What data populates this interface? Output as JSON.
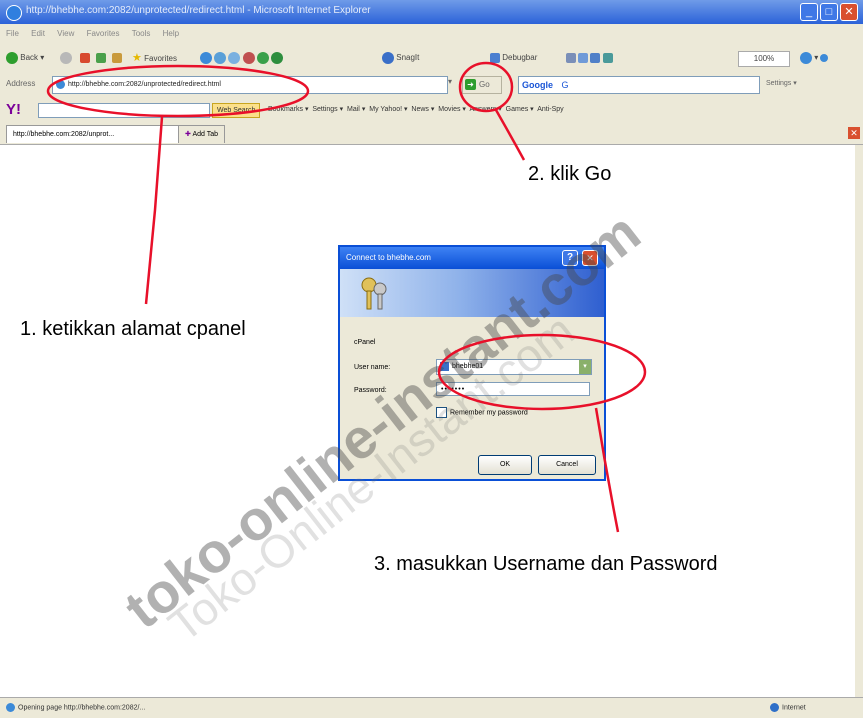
{
  "browser": {
    "title": "http://bhebhe.com:2082/unprotected/redirect.html - Microsoft Internet Explorer",
    "window_buttons": [
      "_",
      "□",
      "✕"
    ],
    "menu": [
      "File",
      "Edit",
      "View",
      "Favorites",
      "Tools",
      "Help"
    ],
    "toolbar": {
      "back": "Back",
      "favorites": "Favorites",
      "snagit": "SnagIt",
      "debugbar": "Debugbar",
      "zoom": "100%"
    },
    "address": {
      "label": "Address",
      "url": "http://bhebhe.com:2082/unprotected/redirect.html",
      "go_label": "Go"
    },
    "google": {
      "logo": "Google",
      "input": "G",
      "settings": "Settings"
    },
    "yahoo": {
      "logo": "Y!",
      "search": "Web Search",
      "items": [
        "Bookmarks",
        "Settings",
        "Mail",
        "My Yahoo!",
        "News",
        "Movies",
        "Answers",
        "Games",
        "Anti-Spy"
      ]
    },
    "tabs": {
      "active": "http://bhebhe.com:2082/unprot...",
      "add": "Add Tab"
    },
    "status": {
      "text": "Opening page http://bhebhe.com:2082/...",
      "zone": "Internet"
    }
  },
  "dialog": {
    "title": "Connect to bhebhe.com",
    "help_btn": "?",
    "close_btn": "✕",
    "realm": "cPanel",
    "username_label": "User name:",
    "username_value": "bhebhe01",
    "password_label": "Password:",
    "password_value": "•••••••",
    "remember_label": "Remember my password",
    "ok_label": "OK",
    "cancel_label": "Cancel"
  },
  "annotations": {
    "step1": "1. ketikkan alamat cpanel",
    "step2": "2. klik Go",
    "step3": "3. masukkan Username dan Password"
  },
  "watermark": {
    "primary": "toko-online-instant.com",
    "secondary": "Toko-Online-Instant.com"
  },
  "colors": {
    "annotation": "#e8102a",
    "xp_blue": "#0a4fd6"
  }
}
